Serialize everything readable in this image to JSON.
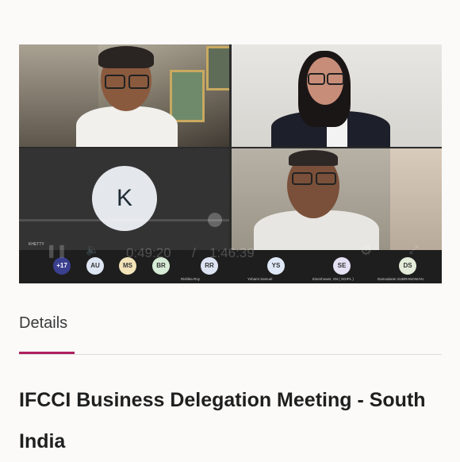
{
  "video": {
    "tiles": [
      {
        "type": "camera"
      },
      {
        "type": "camera"
      },
      {
        "type": "avatar",
        "initial": "K",
        "name": "KHETTY"
      },
      {
        "type": "camera"
      }
    ],
    "controls": {
      "current_time": "0:49:20",
      "separator": "/",
      "duration": "1:46:39",
      "play_icon": "pause-icon",
      "volume_icon": "volume-icon",
      "settings_icon": "gear-icon",
      "expand_icon": "expand-icon"
    },
    "participants": [
      {
        "initials": "+17",
        "name": "",
        "color": "#3a3f8f",
        "text_color": "#ffffff"
      },
      {
        "initials": "AU",
        "name": "",
        "color": "#dfe6f3",
        "text_color": "#333333"
      },
      {
        "initials": "MS",
        "name": "",
        "color": "#f2e3b8",
        "text_color": "#333333"
      },
      {
        "initials": "BR",
        "name": "",
        "color": "#d6ecd6",
        "text_color": "#333333"
      },
      {
        "initials": "RR",
        "name": "Rishika Roy",
        "color": "#dde3f3",
        "text_color": "#333333"
      },
      {
        "initials": "YS",
        "name": "Yohami Samuel",
        "color": "#dfe8f7",
        "text_color": "#333333"
      },
      {
        "initials": "SE",
        "name": "Eisenhower, SN ( SGIPL )",
        "color": "#e6e0f3",
        "text_color": "#333333"
      },
      {
        "initials": "DS",
        "name": "Damodaran SUBRAMANIAN",
        "color": "#e3ecd8",
        "text_color": "#333333"
      }
    ]
  },
  "tabs": {
    "details_label": "Details",
    "accent_color": "#b0205e"
  },
  "meeting": {
    "title": "IFCCI Business Delegation Meeting - South India"
  }
}
